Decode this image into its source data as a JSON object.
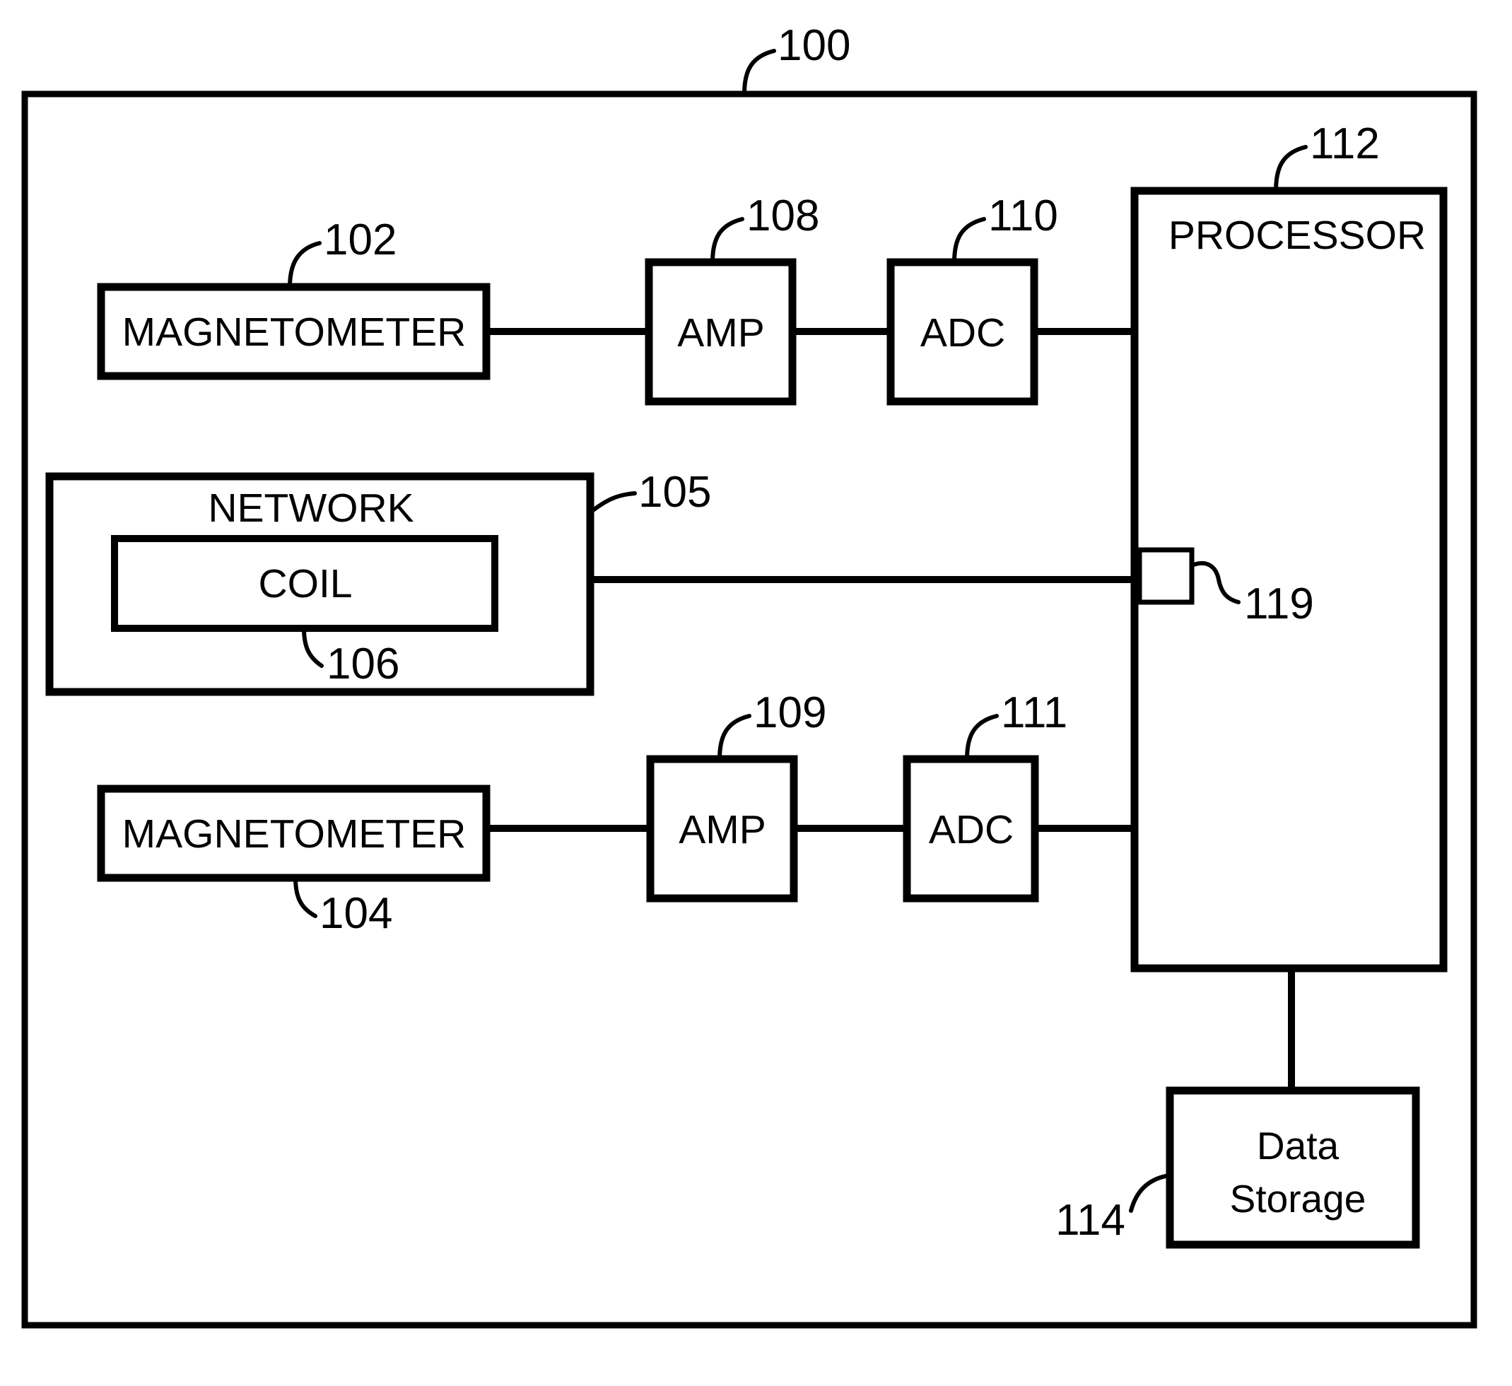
{
  "figure": {
    "type": "patent-block-diagram",
    "system_reference": "100",
    "background_color": "#ffffff",
    "line_color": "#000000"
  },
  "blocks": {
    "magnetometer_top": {
      "label": "MAGNETOMETER",
      "ref": "102"
    },
    "magnetometer_bottom": {
      "label": "MAGNETOMETER",
      "ref": "104"
    },
    "network": {
      "label": "NETWORK",
      "ref": "105"
    },
    "coil": {
      "label": "COIL",
      "ref": "106"
    },
    "amp_top": {
      "label": "AMP",
      "ref": "108"
    },
    "amp_bottom": {
      "label": "AMP",
      "ref": "109"
    },
    "adc_top": {
      "label": "ADC",
      "ref": "110"
    },
    "adc_bottom": {
      "label": "ADC",
      "ref": "111"
    },
    "processor": {
      "label": "PROCESSOR",
      "ref": "112"
    },
    "port": {
      "label": "",
      "ref": "119"
    },
    "data_storage": {
      "label_line1": "Data",
      "label_line2": "Storage",
      "ref": "114"
    }
  },
  "connections": [
    {
      "from": "magnetometer_top",
      "to": "amp_top"
    },
    {
      "from": "amp_top",
      "to": "adc_top"
    },
    {
      "from": "adc_top",
      "to": "processor"
    },
    {
      "from": "coil",
      "to": "port"
    },
    {
      "from": "magnetometer_bottom",
      "to": "amp_bottom"
    },
    {
      "from": "amp_bottom",
      "to": "adc_bottom"
    },
    {
      "from": "adc_bottom",
      "to": "processor"
    },
    {
      "from": "processor",
      "to": "data_storage"
    }
  ]
}
